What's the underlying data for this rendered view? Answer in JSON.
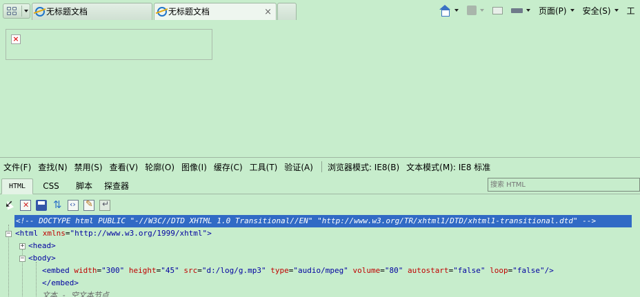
{
  "browser": {
    "tabs": [
      {
        "title": "无标题文档",
        "active": false
      },
      {
        "title": "无标题文档",
        "active": true
      }
    ],
    "close_symbol": "×",
    "commands": {
      "page": "页面(P)",
      "safety": "安全(S)",
      "tools_partial": "工"
    }
  },
  "content": {
    "broken_image_symbol": "×"
  },
  "devtools": {
    "menu": {
      "file": "文件(F)",
      "find": "查找(N)",
      "disable": "禁用(S)",
      "view": "查看(V)",
      "outline": "轮廓(O)",
      "images": "图像(I)",
      "cache": "缓存(C)",
      "tools": "工具(T)",
      "validate": "验证(A)",
      "browser_mode": "浏览器模式: IE8(B)",
      "document_mode": "文本模式(M): IE8 标准"
    },
    "tabs": {
      "html": "HTML",
      "css": "CSS",
      "script": "脚本",
      "profiler": "探查器"
    },
    "search_placeholder": "搜索 HTML",
    "tree": {
      "doctype": "<!-- DOCTYPE html PUBLIC \"-//W3C//DTD XHTML 1.0 Transitional//EN\" \"http://www.w3.org/TR/xhtml1/DTD/xhtml1-transitional.dtd\" -->",
      "html_open": "<html",
      "html_attr": "xmlns",
      "html_val": "\"http://www.w3.org/1999/xhtml\"",
      "html_close": ">",
      "head": "<head>",
      "body": "<body>",
      "embed_open": "<embed",
      "embed_attrs": [
        {
          "name": "width",
          "value": "\"300\""
        },
        {
          "name": "height",
          "value": "\"45\""
        },
        {
          "name": "src",
          "value": "\"d:/log/g.mp3\""
        },
        {
          "name": "type",
          "value": "\"audio/mpeg\""
        },
        {
          "name": "volume",
          "value": "\"80\""
        },
        {
          "name": "autostart",
          "value": "\"false\""
        },
        {
          "name": "loop",
          "value": "\"false\""
        }
      ],
      "embed_selfclose": "/>",
      "embed_end": "</embed>",
      "text_node": "文本 - 空文本节点",
      "expand_symbol": "+",
      "collapse_symbol": "−"
    }
  }
}
